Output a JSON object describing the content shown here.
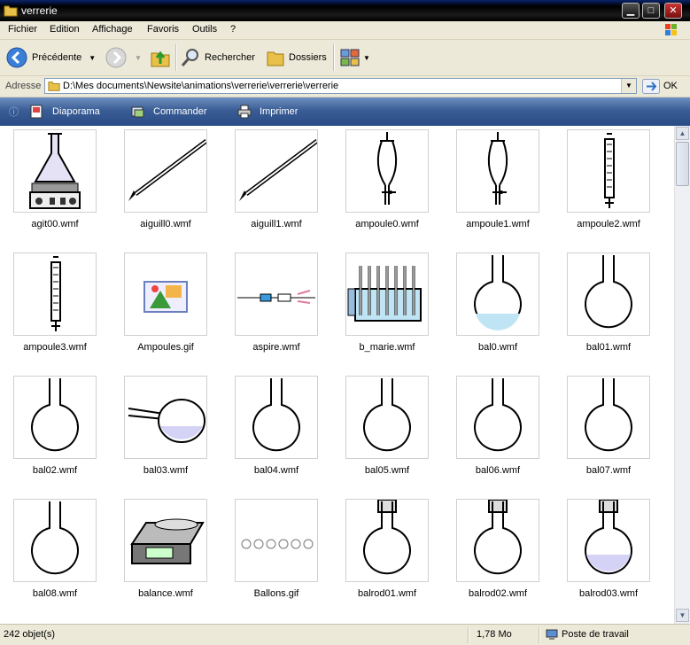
{
  "window": {
    "title": "verrerie"
  },
  "menu": {
    "items": [
      "Fichier",
      "Edition",
      "Affichage",
      "Favoris",
      "Outils",
      "?"
    ]
  },
  "toolbar": {
    "back_label": "Précédente",
    "search_label": "Rechercher",
    "folders_label": "Dossiers"
  },
  "address": {
    "label": "Adresse",
    "path": "D:\\Mes documents\\Newsite\\animations\\verrerie\\verrerie\\verrerie",
    "go_label": "OK"
  },
  "tasks": {
    "slideshow": "Diaporama",
    "order": "Commander",
    "print": "Imprimer"
  },
  "files": [
    {
      "name": "agit00.wmf",
      "icon": "stirrer-hotplate-icon"
    },
    {
      "name": "aiguill0.wmf",
      "icon": "needle-icon"
    },
    {
      "name": "aiguill1.wmf",
      "icon": "needle-icon"
    },
    {
      "name": "ampoule0.wmf",
      "icon": "separatory-funnel-icon"
    },
    {
      "name": "ampoule1.wmf",
      "icon": "separatory-funnel-icon"
    },
    {
      "name": "ampoule2.wmf",
      "icon": "burette-funnel-icon"
    },
    {
      "name": "ampoule3.wmf",
      "icon": "burette-funnel-icon"
    },
    {
      "name": "Ampoules.gif",
      "icon": "image-file-icon"
    },
    {
      "name": "aspire.wmf",
      "icon": "aspirator-icon"
    },
    {
      "name": "b_marie.wmf",
      "icon": "water-bath-icon"
    },
    {
      "name": "bal0.wmf",
      "icon": "flask-icon"
    },
    {
      "name": "bal01.wmf",
      "icon": "flask-icon"
    },
    {
      "name": "bal02.wmf",
      "icon": "flask-icon"
    },
    {
      "name": "bal03.wmf",
      "icon": "retort-icon"
    },
    {
      "name": "bal04.wmf",
      "icon": "flask-icon"
    },
    {
      "name": "bal05.wmf",
      "icon": "flask-icon"
    },
    {
      "name": "bal06.wmf",
      "icon": "flask-icon"
    },
    {
      "name": "bal07.wmf",
      "icon": "flask-icon"
    },
    {
      "name": "bal08.wmf",
      "icon": "flask-icon"
    },
    {
      "name": "balance.wmf",
      "icon": "scale-icon"
    },
    {
      "name": "Ballons.gif",
      "icon": "balloons-icon"
    },
    {
      "name": "balrod01.wmf",
      "icon": "ground-neck-flask-icon"
    },
    {
      "name": "balrod02.wmf",
      "icon": "ground-neck-flask-icon"
    },
    {
      "name": "balrod03.wmf",
      "icon": "ground-neck-flask-icon"
    }
  ],
  "status": {
    "count": "242 objet(s)",
    "size": "1,78 Mo",
    "location": "Poste de travail"
  }
}
